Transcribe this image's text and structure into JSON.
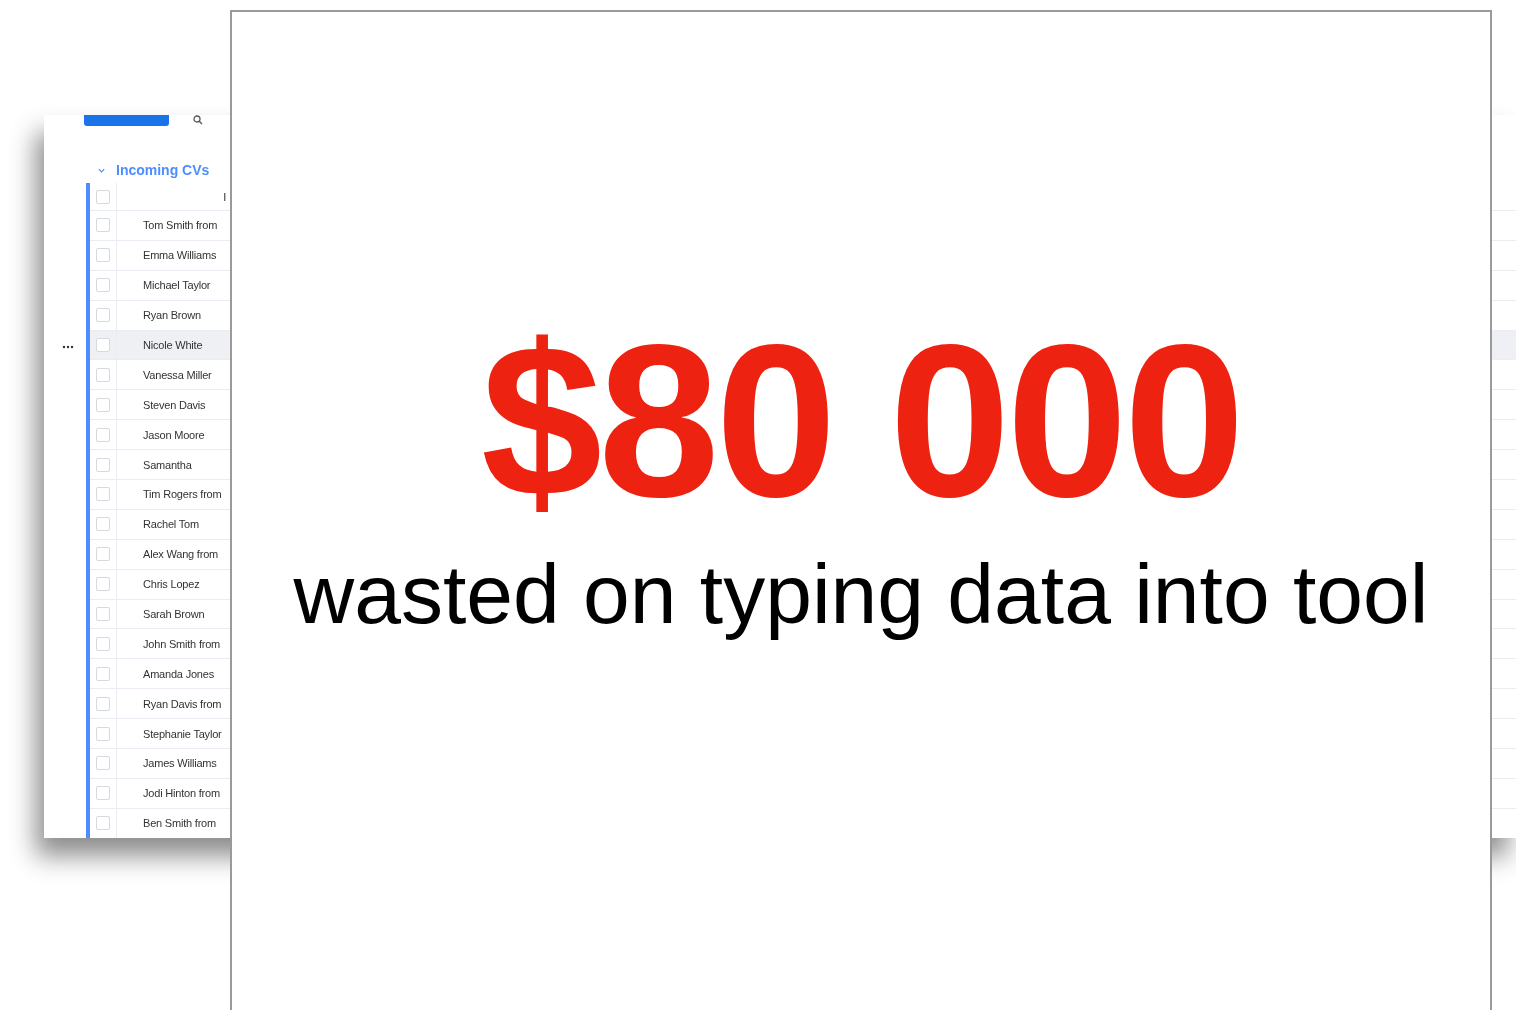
{
  "group": {
    "title": "Incoming CVs",
    "expanded": true
  },
  "table": {
    "columns": [
      "I"
    ],
    "select_all_checked": false,
    "rows": [
      {
        "name": "Tom Smith from",
        "checked": false,
        "highlighted": false
      },
      {
        "name": "Emma Williams",
        "checked": false,
        "highlighted": false
      },
      {
        "name": "Michael Taylor",
        "checked": false,
        "highlighted": false
      },
      {
        "name": "Ryan Brown",
        "checked": false,
        "highlighted": false
      },
      {
        "name": "Nicole White",
        "checked": false,
        "highlighted": true
      },
      {
        "name": "Vanessa Miller",
        "checked": false,
        "highlighted": false
      },
      {
        "name": "Steven Davis",
        "checked": false,
        "highlighted": false
      },
      {
        "name": "Jason Moore",
        "checked": false,
        "highlighted": false
      },
      {
        "name": "Samantha",
        "checked": false,
        "highlighted": false
      },
      {
        "name": "Tim Rogers from",
        "checked": false,
        "highlighted": false
      },
      {
        "name": "Rachel Tom",
        "checked": false,
        "highlighted": false
      },
      {
        "name": "Alex Wang from",
        "checked": false,
        "highlighted": false
      },
      {
        "name": "Chris Lopez",
        "checked": false,
        "highlighted": false
      },
      {
        "name": "Sarah Brown",
        "checked": false,
        "highlighted": false
      },
      {
        "name": "John Smith from",
        "checked": false,
        "highlighted": false
      },
      {
        "name": "Amanda Jones",
        "checked": false,
        "highlighted": false
      },
      {
        "name": "Ryan Davis from",
        "checked": false,
        "highlighted": false
      },
      {
        "name": "Stephanie Taylor",
        "checked": false,
        "highlighted": false
      },
      {
        "name": "James Williams",
        "checked": false,
        "highlighted": false
      },
      {
        "name": "Jodi Hinton from",
        "checked": false,
        "highlighted": false
      },
      {
        "name": "Ben Smith from",
        "checked": false,
        "highlighted": false
      }
    ]
  },
  "headline": {
    "amount": "$80 000",
    "text": "wasted on typing data into tool"
  }
}
